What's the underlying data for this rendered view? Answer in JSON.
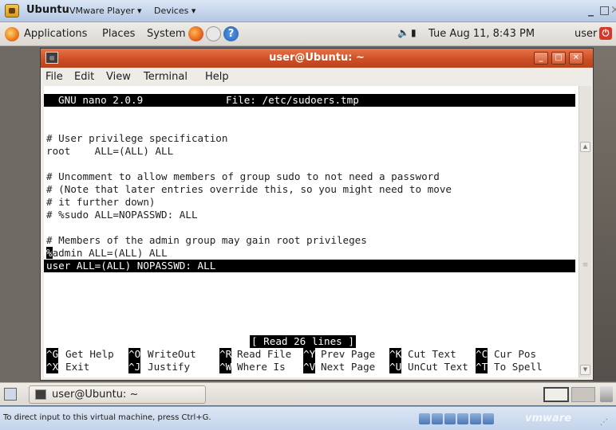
{
  "vmware": {
    "app_title": "Ubuntu",
    "menu": [
      "VMware Player ▾",
      "Devices ▾"
    ],
    "window_buttons": {
      "minimize": "_",
      "maximize": "□",
      "close": "✕"
    },
    "status_text": "To direct input to this virtual machine, press Ctrl+G.",
    "brand": "vmware"
  },
  "gnome_panel": {
    "menus": [
      "Applications",
      "Places",
      "System"
    ],
    "clock": "Tue Aug 11,  8:43 PM",
    "user": "user"
  },
  "terminal": {
    "window_title": "user@Ubuntu: ~",
    "menu": [
      "File",
      "Edit",
      "View",
      "Terminal",
      "Help"
    ]
  },
  "nano": {
    "version": "GNU nano 2.0.9",
    "file": "File: /etc/sudoers.tmp",
    "lines": [
      "",
      "",
      "# User privilege specification",
      "root    ALL=(ALL) ALL",
      "",
      "# Uncomment to allow members of group sudo to not need a password",
      "# (Note that later entries override this, so you might need to move",
      "# it further down)",
      "# %sudo ALL=NOPASSWD: ALL",
      "",
      "# Members of the admin group may gain root privileges",
      "admin ALL=(ALL) ALL",
      "user ALL=(ALL) NOPASSWD: ALL"
    ],
    "cursor_char": "%",
    "status": "[ Read 26 lines ]",
    "shortcuts_row1": [
      {
        "key": "^G",
        "label": "Get Help"
      },
      {
        "key": "^O",
        "label": "WriteOut"
      },
      {
        "key": "^R",
        "label": "Read File"
      },
      {
        "key": "^Y",
        "label": "Prev Page"
      },
      {
        "key": "^K",
        "label": "Cut Text"
      },
      {
        "key": "^C",
        "label": "Cur Pos"
      }
    ],
    "shortcuts_row2": [
      {
        "key": "^X",
        "label": "Exit"
      },
      {
        "key": "^J",
        "label": "Justify"
      },
      {
        "key": "^W",
        "label": "Where Is"
      },
      {
        "key": "^V",
        "label": "Next Page"
      },
      {
        "key": "^U",
        "label": "UnCut Text"
      },
      {
        "key": "^T",
        "label": "To Spell"
      }
    ]
  },
  "taskbar": {
    "task_label": "user@Ubuntu: ~"
  },
  "colors": {
    "terminal_titlebar": "#cf4f24",
    "vmware_chrome": "#c3d4eb",
    "nano_header_bg": "#000000"
  }
}
